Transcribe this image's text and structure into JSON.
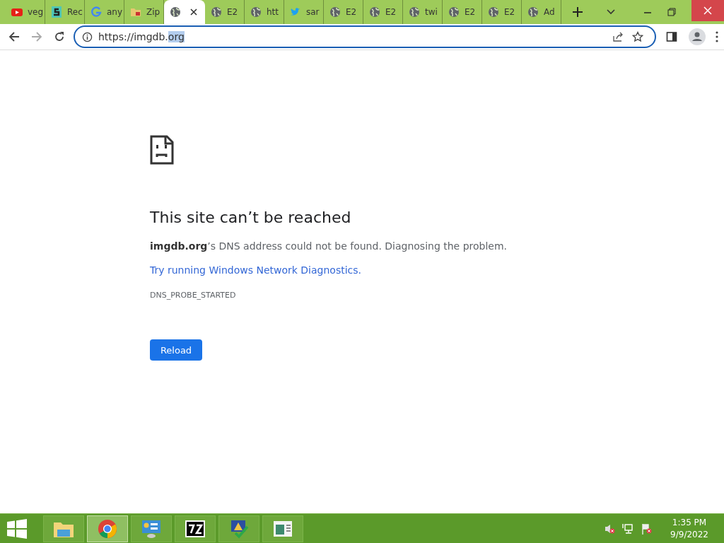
{
  "tabs": [
    {
      "kind": "video",
      "title": "veg",
      "selected": false
    },
    {
      "kind": "s-logo",
      "title": "Rec",
      "selected": false
    },
    {
      "kind": "g-logo",
      "title": "any",
      "selected": false
    },
    {
      "kind": "archive",
      "title": "Zip",
      "selected": false
    },
    {
      "kind": "globe",
      "selected": true
    },
    {
      "kind": "globe",
      "title": "E2",
      "selected": false
    },
    {
      "kind": "globe",
      "title": "htt",
      "selected": false
    },
    {
      "kind": "bird",
      "title": "sar",
      "selected": false
    },
    {
      "kind": "globe",
      "title": "E2",
      "selected": false
    },
    {
      "kind": "globe",
      "title": "E2",
      "selected": false
    },
    {
      "kind": "globe",
      "title": "twi",
      "selected": false
    },
    {
      "kind": "globe",
      "title": "E2",
      "selected": false
    },
    {
      "kind": "globe",
      "title": "E2",
      "selected": false
    },
    {
      "kind": "globe",
      "title": "Ad",
      "selected": false
    }
  ],
  "address_bar": {
    "url": "https://imgdb.",
    "selected_text": "org"
  },
  "error_page": {
    "heading": "This site can’t be reached",
    "message": "**imgdb.org**’s DNS address could not be found. Diagnosing the problem.",
    "link": "Try running Windows Network Diagnostics.",
    "error_code": "DNS_PROBE_STARTED",
    "button": "Reload"
  },
  "taskbar": {
    "apps": [
      {
        "kind": "folder",
        "selected": false
      },
      {
        "kind": "chrome",
        "selected": true
      },
      {
        "kind": "control-panel",
        "selected": false
      },
      {
        "kind": "sevenzip",
        "selected": false
      },
      {
        "kind": "warning",
        "selected": false
      },
      {
        "kind": "window",
        "selected": false
      }
    ],
    "time": "1:35 PM",
    "date": "9/9/2022"
  }
}
